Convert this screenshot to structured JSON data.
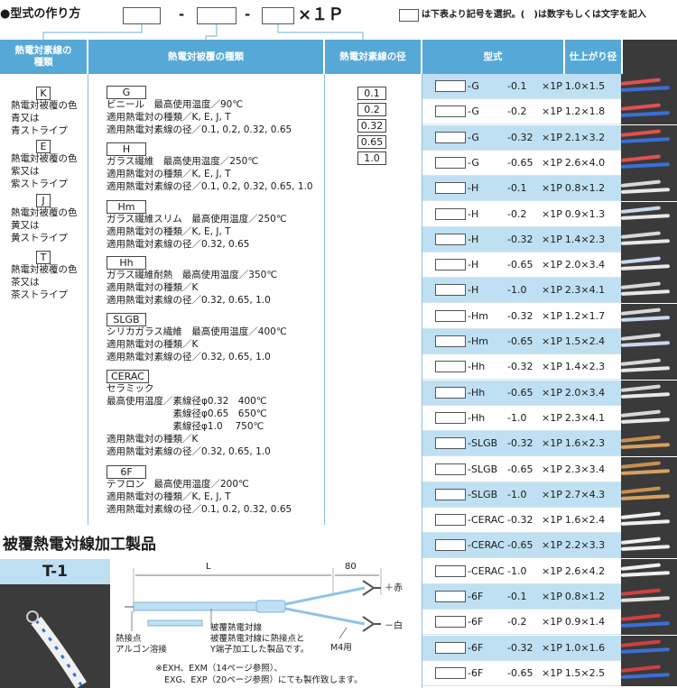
{
  "formula": {
    "title": "●型式の作り方",
    "dash1": "-",
    "dash2": "-",
    "suffix": "×１Ｐ",
    "note": "は下表より記号を選択。(　)は数字もしくは文字を記入"
  },
  "headers": [
    "熱電対素線の\n種類",
    "熱電対被覆の種類",
    "熱電対素線の径",
    "型式",
    "仕上がり径"
  ],
  "types": [
    {
      "code": "K",
      "desc": "熱電対被覆の色\n青又は\n青ストライプ"
    },
    {
      "code": "E",
      "desc": "熱電対被覆の色\n紫又は\n紫ストライプ"
    },
    {
      "code": "J",
      "desc": "熱電対被覆の色\n黄又は\n黄ストライプ"
    },
    {
      "code": "T",
      "desc": "熱電対被覆の色\n茶又は\n茶ストライプ"
    }
  ],
  "coatings": [
    {
      "code": "G",
      "lines": [
        "ビニール　最高使用温度／90℃",
        "適用熱電対の種類／K, E, J, T",
        "適用熱電対素線の径／0.1, 0.2, 0.32, 0.65"
      ]
    },
    {
      "code": "H",
      "lines": [
        "ガラス繊維　最高使用温度／250℃",
        "適用熱電対の種類／K, E, J, T",
        "適用熱電対素線の径／0.1, 0.2, 0.32, 0.65, 1.0"
      ]
    },
    {
      "code": "Hm",
      "lines": [
        "ガラス繊維スリム　最高使用温度／250℃",
        "適用熱電対の種類／K, E, J, T",
        "適用熱電対素線の径／0.32, 0.65"
      ]
    },
    {
      "code": "Hh",
      "lines": [
        "ガラス繊維耐熱　最高使用温度／350℃",
        "適用熱電対の種類／K",
        "適用熱電対素線の径／0.32, 0.65, 1.0"
      ]
    },
    {
      "code": "SLGB",
      "lines": [
        "シリカガラス繊維　最高使用温度／400℃",
        "適用熱電対の種類／K",
        "適用熱電対素線の径／0.32, 0.65, 1.0"
      ]
    },
    {
      "code": "CERAC",
      "lines": [
        "セラミック",
        "最高使用温度／素線径φ0.32　400℃",
        "　　　　　　　素線径φ0.65　650℃",
        "　　　　　　　素線径φ1.0　 750℃",
        "適用熱電対の種類／K",
        "適用熱電対素線の径／0.32, 0.65, 1.0"
      ]
    },
    {
      "code": "6F",
      "lines": [
        "テフロン　最高使用温度／200℃",
        "適用熱電対の種類／K, E, J, T",
        "適用熱電対素線の径／0.1, 0.2, 0.32, 0.65"
      ]
    }
  ],
  "diameters": [
    "0.1",
    "0.2",
    "0.32",
    "0.65",
    "1.0"
  ],
  "models": [
    {
      "code": "-G",
      "opt": "-0.1",
      "p": "×1P",
      "size": "1.0×1.5"
    },
    {
      "code": "-G",
      "opt": "-0.2",
      "p": "×1P",
      "size": "1.2×1.8"
    },
    {
      "code": "-G",
      "opt": "-0.32",
      "p": "×1P",
      "size": "2.1×3.2"
    },
    {
      "code": "-G",
      "opt": "-0.65",
      "p": "×1P",
      "size": "2.6×4.0"
    },
    {
      "code": "-H",
      "opt": "-0.1",
      "p": "×1P",
      "size": "0.8×1.2"
    },
    {
      "code": "-H",
      "opt": "-0.2",
      "p": "×1P",
      "size": "0.9×1.3"
    },
    {
      "code": "-H",
      "opt": "-0.32",
      "p": "×1P",
      "size": "1.4×2.3"
    },
    {
      "code": "-H",
      "opt": "-0.65",
      "p": "×1P",
      "size": "2.0×3.4"
    },
    {
      "code": "-H",
      "opt": "-1.0",
      "p": "×1P",
      "size": "2.3×4.1"
    },
    {
      "code": "-Hm",
      "opt": "-0.32",
      "p": "×1P",
      "size": "1.2×1.7"
    },
    {
      "code": "-Hm",
      "opt": "-0.65",
      "p": "×1P",
      "size": "1.5×2.4"
    },
    {
      "code": "-Hh",
      "opt": "-0.32",
      "p": "×1P",
      "size": "1.4×2.3"
    },
    {
      "code": "-Hh",
      "opt": "-0.65",
      "p": "×1P",
      "size": "2.0×3.4"
    },
    {
      "code": "-Hh",
      "opt": "-1.0",
      "p": "×1P",
      "size": "2.3×4.1"
    },
    {
      "code": "-SLGB",
      "opt": "-0.32",
      "p": "×1P",
      "size": "1.6×2.3"
    },
    {
      "code": "-SLGB",
      "opt": "-0.65",
      "p": "×1P",
      "size": "2.3×3.4"
    },
    {
      "code": "-SLGB",
      "opt": "-1.0",
      "p": "×1P",
      "size": "2.7×4.3"
    },
    {
      "code": "-CERAC",
      "opt": "-0.32",
      "p": "×1P",
      "size": "1.6×2.4"
    },
    {
      "code": "-CERAC",
      "opt": "-0.65",
      "p": "×1P",
      "size": "2.2×3.3"
    },
    {
      "code": "-CERAC",
      "opt": "-1.0",
      "p": "×1P",
      "size": "2.6×4.2"
    },
    {
      "code": "-6F",
      "opt": "-0.1",
      "p": "×1P",
      "size": "0.8×1.2"
    },
    {
      "code": "-6F",
      "opt": "-0.2",
      "p": "×1P",
      "size": "0.9×1.4"
    },
    {
      "code": "-6F",
      "opt": "-0.32",
      "p": "×1P",
      "size": "1.0×1.6"
    },
    {
      "code": "-6F",
      "opt": "-0.65",
      "p": "×1P",
      "size": "1.5×2.5"
    }
  ],
  "wire_colors": [
    "#e05050|#3a6fd8",
    "#e05050|#3a6fd8",
    "#e05050|#3a6fd8",
    "#e05050|#3a6fd8",
    "#d8d8d8|#e8e8e8",
    "#c8d8f0|#e8e8e8",
    "#d8d8d8|#e8e8e8",
    "#c8d8f0|#e8e8e8",
    "#d8d8d8|#e8e8e8",
    "#d8d8d8|#c8d8f0",
    "#d8d8d8|#c8d8f0",
    "#d8d8d8|#e8e8e8",
    "#d8d8d8|#e8e8e8",
    "#d8d8d8|#e8e8e8",
    "#c8904a|#d8a060",
    "#c8904a|#d8a060",
    "#c8904a|#d8a060",
    "#f0f0f0|#f0f0f0",
    "#f0f0f0|#f0f0f0",
    "#f0f0f0|#f0f0f0",
    "#d04040|#e0e0e0",
    "#d04040|#3a6fd8",
    "#d04040|#3a6fd8",
    "#d04040|#3a6fd8"
  ],
  "section2": {
    "title": "被覆熱電対線加工製品",
    "product_code": "T-1",
    "dim_L": "L",
    "dim_80": "80",
    "plus_label": "＋赤",
    "minus_label": "－白",
    "lbl_a": "熱接点\nアルゴン溶接",
    "lbl_b": "被覆熱電対線\n被覆熱電対線に熱接点と\nY端子加工した製品です。",
    "lbl_m4": "M4用",
    "note1": "※EXH、EXM（14ページ参照）、",
    "note2": "EXG、EXP（20ページ参照）にても製作致します。"
  },
  "colors": {
    "header": "#56a8d6",
    "row_alt": "#bfe0f2"
  }
}
